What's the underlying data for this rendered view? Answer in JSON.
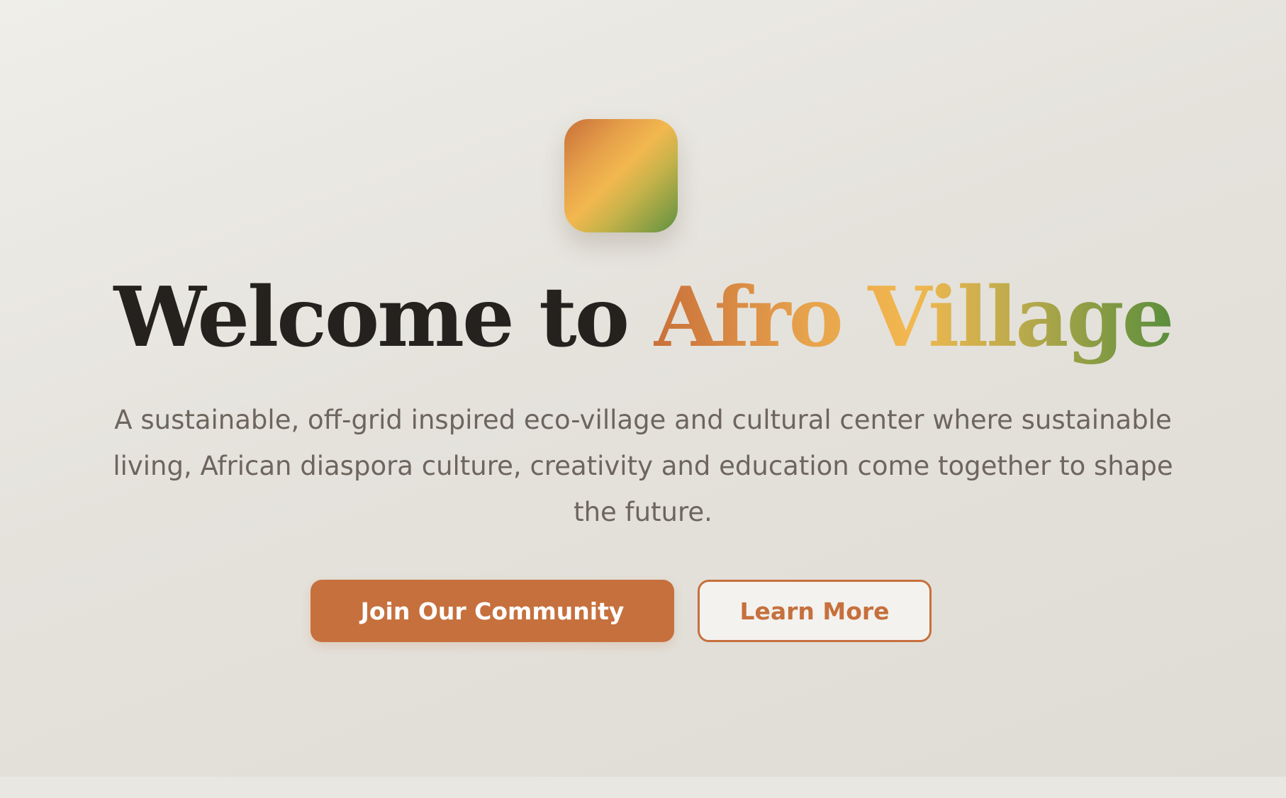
{
  "hero": {
    "title_main": "Welcome to ",
    "title_accent": "Afro Village",
    "subtitle": "A sustainable, off-grid inspired eco-village and cultural center where sustainable living, African diaspora culture, creativity and education come together to shape the future.",
    "primary_button": "Join Our Community",
    "secondary_button": "Learn More"
  },
  "colors": {
    "accent": "#c6703d",
    "gold": "#f2b84f",
    "green": "#5a8e3c",
    "heading": "#24211f",
    "body_text": "#6d655e",
    "background": "#e5e2dc"
  }
}
